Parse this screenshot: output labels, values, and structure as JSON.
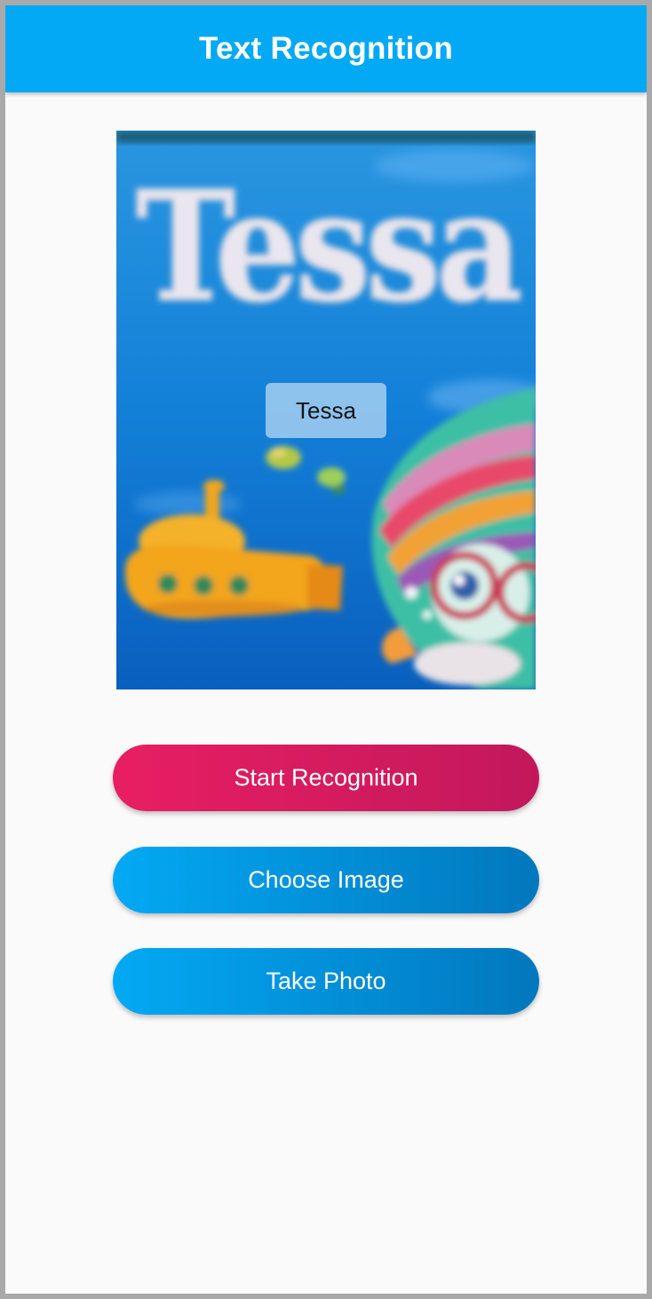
{
  "app_bar": {
    "title": "Text Recognition"
  },
  "image_preview": {
    "picture_text": "Tessa",
    "recognized_text": "Tessa"
  },
  "buttons": {
    "start_recognition": "Start Recognition",
    "choose_image": "Choose Image",
    "take_photo": "Take Photo"
  },
  "colors": {
    "app_bar": "#03a9f4",
    "start_button_from": "#e91e63",
    "start_button_to": "#c2185b",
    "blue_button_from": "#03a9f4",
    "blue_button_to": "#0277bd",
    "background": "#fafafa"
  }
}
